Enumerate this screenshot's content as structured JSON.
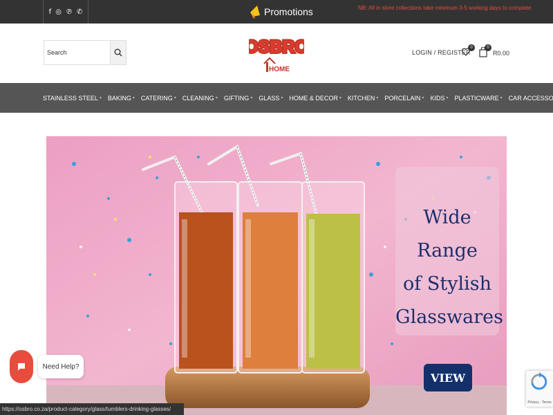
{
  "topbar": {
    "socials": [
      "facebook-icon",
      "instagram-icon",
      "pinterest-icon",
      "whatsapp-icon"
    ],
    "promo_label": "Promotions",
    "notice": "NB: All in store collections take minimum 3-5 working days to complete."
  },
  "header": {
    "search_placeholder": "Search",
    "logo_text": "OSBRO",
    "logo_sub": "HOME",
    "login_label": "LOGIN / REGISTER",
    "wishlist_count": "0",
    "cart_count": "0",
    "cart_total": "R0.00"
  },
  "nav": {
    "items": [
      {
        "label": "STAINLESS STEEL"
      },
      {
        "label": "BAKING"
      },
      {
        "label": "CATERING"
      },
      {
        "label": "CLEANING"
      },
      {
        "label": "GIFTING"
      },
      {
        "label": "GLASS"
      },
      {
        "label": "HOME & DECOR"
      },
      {
        "label": "KITCHEN"
      },
      {
        "label": "PORCELAIN"
      },
      {
        "label": "KIDS"
      },
      {
        "label": "PLASTICWARE"
      },
      {
        "label": "CAR ACCESSORIES"
      }
    ]
  },
  "banner": {
    "line1": "Wide Range",
    "line2": "of Stylish",
    "line3": "Glasswares",
    "button_label": "VIEW"
  },
  "help": {
    "label": "Need Help?"
  },
  "status_url": "https://osbro.co.za/product-category/glass/tumblers-drinking-glasses/",
  "recaptcha": {
    "text": "Privacy - Terms"
  },
  "colors": {
    "topbar": "#333333",
    "nav": "#555555",
    "notice": "#e74c3c",
    "headline": "#1c2f6b",
    "button": "#14306b",
    "help": "#e74c3c"
  }
}
